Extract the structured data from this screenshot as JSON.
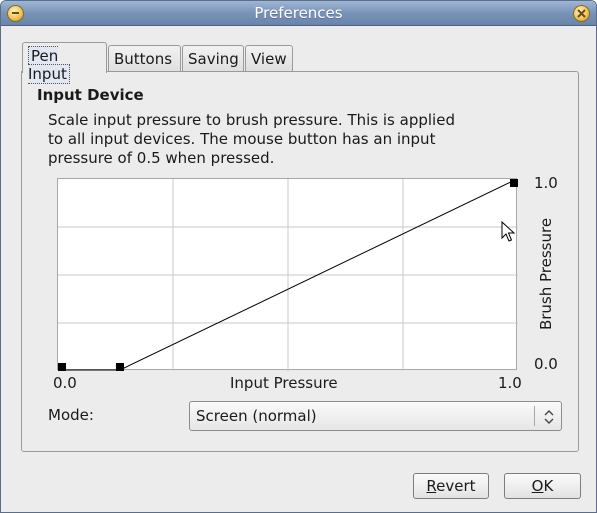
{
  "window": {
    "title": "Preferences"
  },
  "tabs": [
    {
      "label": "Pen Input",
      "active": true
    },
    {
      "label": "Buttons",
      "active": false
    },
    {
      "label": "Saving",
      "active": false
    },
    {
      "label": "View",
      "active": false
    }
  ],
  "section": {
    "title": "Input Device",
    "description": "Scale input pressure to brush pressure. This is applied to all input devices. The mouse button has an input pressure of 0.5 when pressed."
  },
  "graph": {
    "x_label": "Input Pressure",
    "y_label": "Brush Pressure",
    "x_ticks": [
      "0.0",
      "1.0"
    ],
    "y_ticks": [
      "1.0",
      "0.0"
    ],
    "curve_points": [
      {
        "input": 0.0,
        "brush": 0.0
      },
      {
        "input": 0.135,
        "brush": 0.0
      },
      {
        "input": 1.0,
        "brush": 1.0
      }
    ]
  },
  "mode": {
    "label": "Mode:",
    "selected": "Screen (normal)"
  },
  "buttons": {
    "revert_label": "Revert",
    "ok_label": "OK"
  },
  "icons": {
    "titlebar_menu": "window-menu-icon",
    "titlebar_close": "close-icon",
    "combo_arrows": "up-down-arrows-icon",
    "cursor": "mouse-pointer-icon"
  },
  "colors": {
    "titlebar": "#7993b8",
    "window_bg": "#ececec",
    "window_button": "#f0c45a"
  }
}
